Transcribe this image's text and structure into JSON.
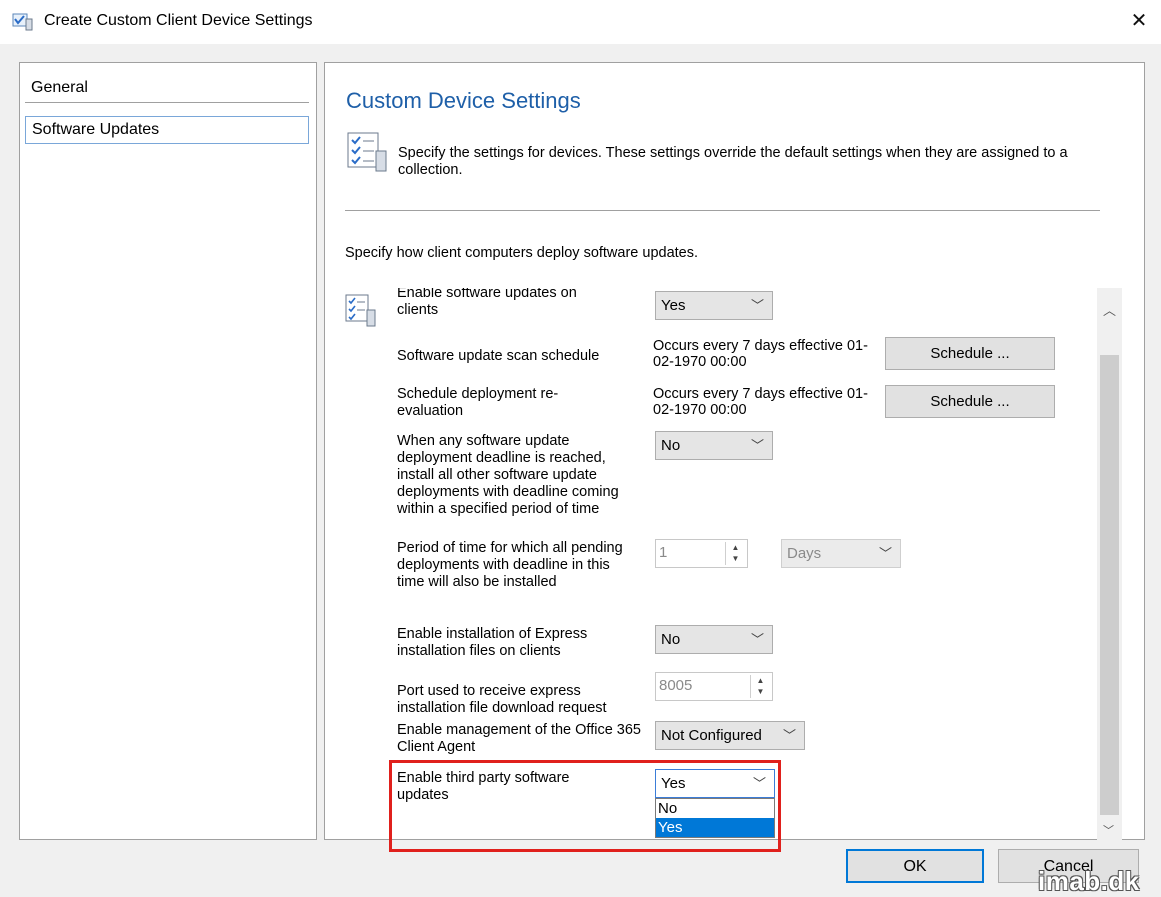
{
  "window": {
    "title": "Create Custom Client Device Settings",
    "close_label": "✕"
  },
  "nav": {
    "items": [
      {
        "label": "General"
      },
      {
        "label": "Software Updates"
      }
    ]
  },
  "page": {
    "title": "Custom Device Settings",
    "description": "Specify the settings for devices. These settings override the default settings when they are assigned to a collection.",
    "intro": "Specify how client computers deploy software updates."
  },
  "settings": [
    {
      "label": "Enable software updates on clients",
      "value": "Yes"
    },
    {
      "label": "Software update scan schedule",
      "value": "Occurs every 7 days effective 01-02-1970 00:00",
      "button": "Schedule ..."
    },
    {
      "label": "Schedule deployment re-evaluation",
      "value": "Occurs every 7 days effective 01-02-1970 00:00",
      "button": "Schedule ..."
    },
    {
      "label": "When any software update deployment deadline is reached, install all other software update deployments with deadline coming within a specified period of time",
      "value": "No"
    },
    {
      "label": "Period of time for which all pending deployments with deadline in this time will also be installed",
      "value": "1",
      "unit": "Days"
    },
    {
      "label": "Enable installation of Express installation files on clients",
      "value": "No"
    },
    {
      "label": "Port used to receive express installation file download request",
      "value": "8005"
    },
    {
      "label": "Enable management of the Office 365 Client Agent",
      "value": "Not Configured"
    },
    {
      "label": "Enable third party software updates",
      "value": "Yes",
      "options": [
        "No",
        "Yes"
      ],
      "selected_option": "Yes"
    }
  ],
  "footer": {
    "ok_label": "OK",
    "cancel_label": "Cancel"
  },
  "watermark": "imab.dk",
  "colors": {
    "title_blue": "#1e5fa8",
    "highlight_red": "#e0201c",
    "selection_blue": "#0078d7"
  }
}
